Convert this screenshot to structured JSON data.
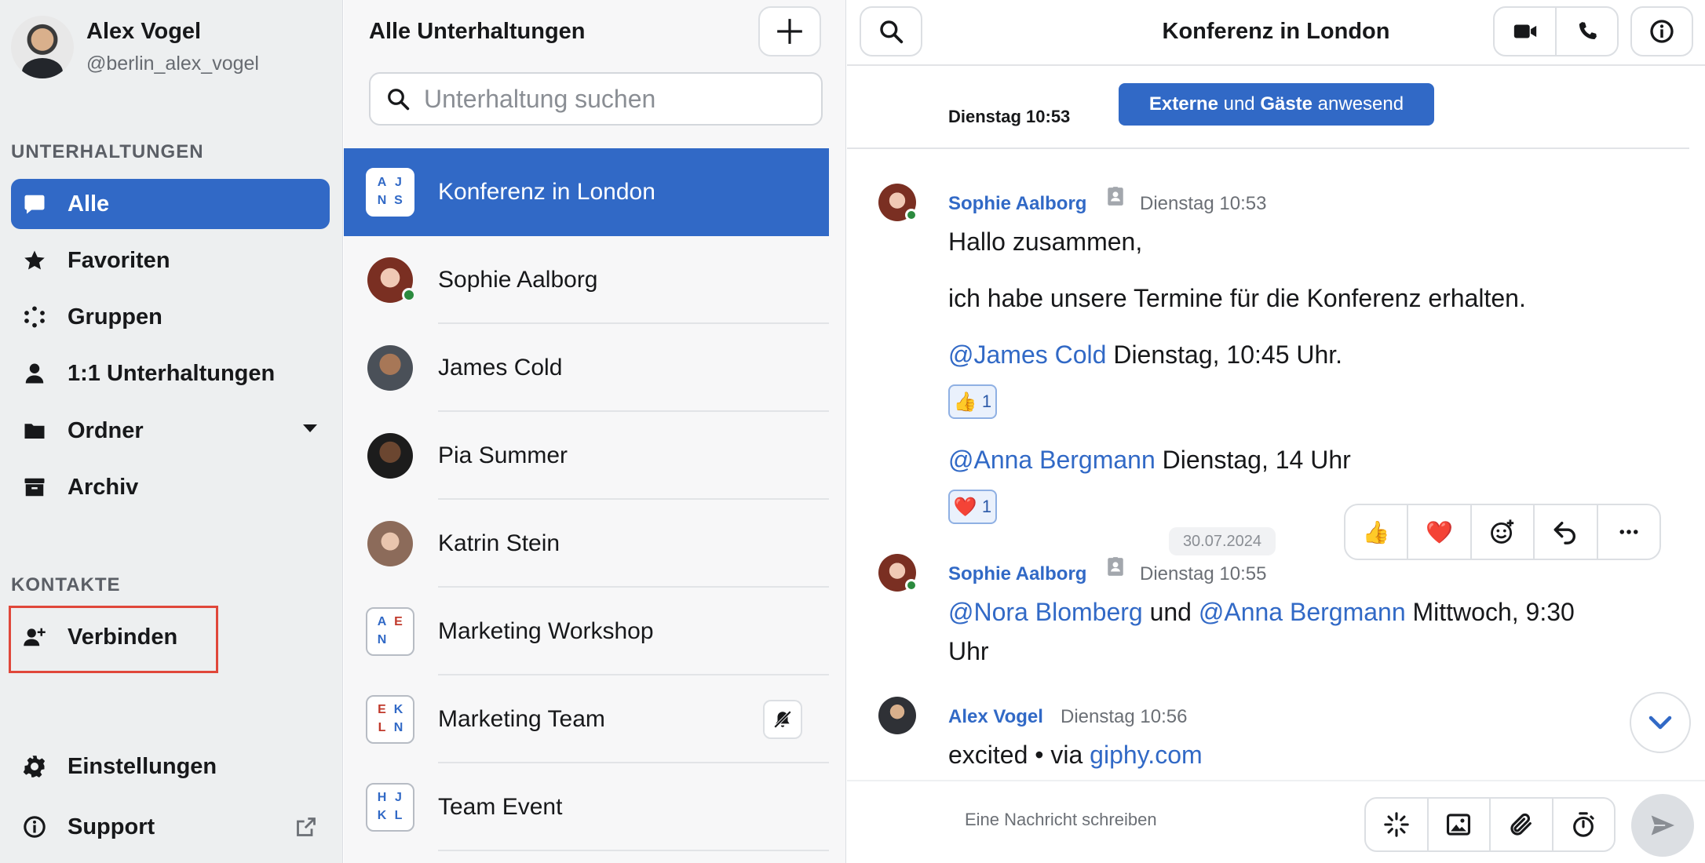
{
  "sidebar": {
    "profile": {
      "name": "Alex Vogel",
      "handle": "@berlin_alex_vogel"
    },
    "section_conversations": "UNTERHALTUNGEN",
    "items": [
      {
        "label": "Alle",
        "icon": "chat-bubble-icon"
      },
      {
        "label": "Favoriten",
        "icon": "star-icon"
      },
      {
        "label": "Gruppen",
        "icon": "groups-icon"
      },
      {
        "label": "1:1 Unterhaltungen",
        "icon": "person-icon"
      },
      {
        "label": "Ordner",
        "icon": "folder-icon"
      },
      {
        "label": "Archiv",
        "icon": "archive-icon"
      }
    ],
    "section_contacts": "KONTAKTE",
    "connect_label": "Verbinden",
    "settings_label": "Einstellungen",
    "support_label": "Support"
  },
  "conversations": {
    "title": "Alle Unterhaltungen",
    "search_placeholder": "Unterhaltung suchen",
    "items": [
      {
        "name": "Konferenz in London",
        "type": "group",
        "initials": [
          "A",
          "J",
          "N",
          "S"
        ]
      },
      {
        "name": "Sophie Aalborg",
        "type": "person",
        "online": true
      },
      {
        "name": "James Cold",
        "type": "person"
      },
      {
        "name": "Pia Summer",
        "type": "person"
      },
      {
        "name": "Katrin Stein",
        "type": "person"
      },
      {
        "name": "Marketing Workshop",
        "type": "group",
        "initials": [
          "A",
          "E",
          "N",
          ""
        ]
      },
      {
        "name": "Marketing Team",
        "type": "group",
        "initials": [
          "E",
          "K",
          "L",
          "N"
        ],
        "muted": true
      },
      {
        "name": "Team Event",
        "type": "group",
        "initials": [
          "H",
          "J",
          "K",
          "L"
        ]
      }
    ]
  },
  "chat": {
    "title": "Konferenz in London",
    "notice": {
      "part1": "Externe",
      "part2": " und ",
      "part3": "Gäste",
      "part4": " anwesend"
    },
    "notice_time": "Dienstag 10:53",
    "messages": [
      {
        "author": "Sophie Aalborg",
        "time": "Dienstag 10:53",
        "line1": "Hallo zusammen,",
        "line2": "ich habe unsere Termine für die Konferenz erhalten.",
        "line3_mention": "@James Cold",
        "line3_text": " Dienstag, 10:45 Uhr.",
        "reaction1": {
          "emoji": "👍",
          "count": "1"
        },
        "line4_mention": "@Anna Bergmann",
        "line4_text": " Dienstag, 14 Uhr",
        "reaction2": {
          "emoji": "❤️",
          "count": "1"
        }
      },
      {
        "author": "Sophie Aalborg",
        "time": "Dienstag 10:55",
        "date_pill": "30.07.2024",
        "mention1": "@Nora Blomberg",
        "joiner": " und ",
        "mention2": "@Anna Bergmann",
        "text": " Mittwoch, 9:30",
        "text2": "Uhr"
      },
      {
        "author": "Alex Vogel",
        "time": "Dienstag 10:56",
        "text": "excited • via ",
        "link": "giphy.com"
      }
    ],
    "reaction_bar": [
      "👍",
      "❤️"
    ],
    "composer_placeholder": "Eine Nachricht schreiben"
  },
  "colors": {
    "accent": "#3169c6",
    "highlight_border": "#e0473a",
    "online": "#2b8a3e"
  }
}
